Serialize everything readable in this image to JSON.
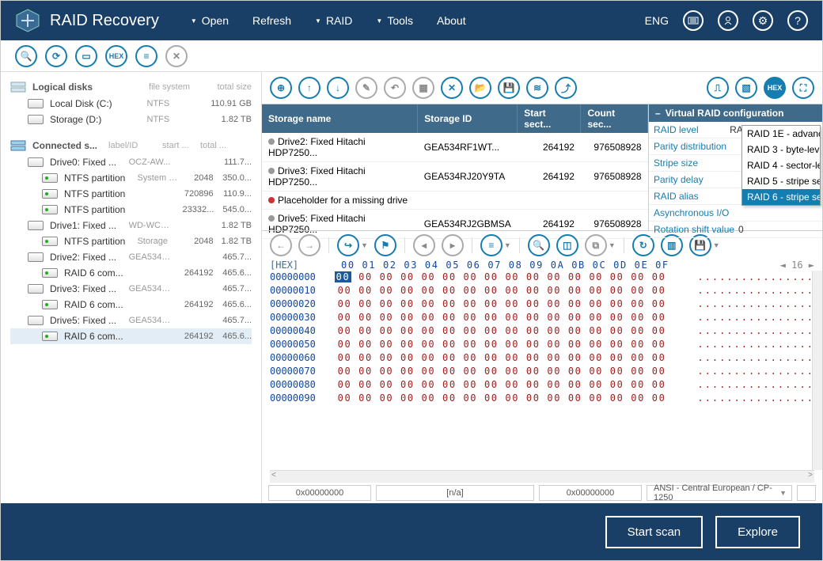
{
  "title": "RAID Recovery",
  "menu": {
    "open": "Open",
    "refresh": "Refresh",
    "raid": "RAID",
    "tools": "Tools",
    "about": "About"
  },
  "lang": "ENG",
  "sidebar": {
    "logical": {
      "title": "Logical disks",
      "col_fs": "file system",
      "col_size": "total size",
      "items": [
        {
          "name": "Local Disk (C:)",
          "fs": "NTFS",
          "size": "110.91 GB"
        },
        {
          "name": "Storage (D:)",
          "fs": "NTFS",
          "size": "1.82 TB"
        }
      ]
    },
    "connected": {
      "title": "Connected s...",
      "col_label": "label/ID",
      "col_start": "start ...",
      "col_total": "total ...",
      "drives": [
        {
          "name": "Drive0: Fixed ...",
          "label": "OCZ-AW...",
          "start": "",
          "total": "111.7...",
          "parts": [
            {
              "name": "NTFS partition",
              "label": "System R...",
              "start": "2048",
              "total": "350.0..."
            },
            {
              "name": "NTFS partition",
              "label": "",
              "start": "720896",
              "total": "110.9..."
            },
            {
              "name": "NTFS partition",
              "label": "",
              "start": "23332...",
              "total": "545.0..."
            }
          ]
        },
        {
          "name": "Drive1: Fixed ...",
          "label": "WD-WCC...",
          "start": "",
          "total": "1.82 TB",
          "parts": [
            {
              "name": "NTFS partition",
              "label": "Storage",
              "start": "2048",
              "total": "1.82 TB"
            }
          ]
        },
        {
          "name": "Drive2: Fixed ...",
          "label": "GEA534R...",
          "start": "",
          "total": "465.7...",
          "parts": [
            {
              "name": "RAID 6 com...",
              "label": "",
              "start": "264192",
              "total": "465.6..."
            }
          ]
        },
        {
          "name": "Drive3: Fixed ...",
          "label": "GEA534R...",
          "start": "",
          "total": "465.7...",
          "parts": [
            {
              "name": "RAID 6 com...",
              "label": "",
              "start": "264192",
              "total": "465.6..."
            }
          ]
        },
        {
          "name": "Drive5: Fixed ...",
          "label": "GEA534R...",
          "start": "",
          "total": "465.7...",
          "parts": [
            {
              "name": "RAID 6 com...",
              "label": "",
              "start": "264192",
              "total": "465.6...",
              "selected": true
            }
          ]
        }
      ]
    }
  },
  "storage": {
    "headers": {
      "name": "Storage name",
      "id": "Storage ID",
      "start": "Start sect...",
      "count": "Count sec..."
    },
    "rows": [
      {
        "name": "Drive2: Fixed Hitachi HDP7250...",
        "id": "GEA534RF1WT...",
        "start": "264192",
        "count": "976508928",
        "dot": "gray"
      },
      {
        "name": "Drive3: Fixed Hitachi HDP7250...",
        "id": "GEA534RJ20Y9TA",
        "start": "264192",
        "count": "976508928",
        "dot": "gray"
      },
      {
        "name": "Placeholder for a missing drive",
        "id": "",
        "start": "",
        "count": "",
        "dot": "red"
      },
      {
        "name": "Drive5: Fixed Hitachi HDP7250...",
        "id": "GEA534RJ2GBMSA",
        "start": "264192",
        "count": "976508928",
        "dot": "gray"
      }
    ]
  },
  "config": {
    "title": "Virtual RAID configuration",
    "rows": {
      "raid_level": "RAID level",
      "raid_level_v": "RAID 5 - stripe se",
      "parity": "Parity distribution",
      "stripe": "Stripe size",
      "pdelay": "Parity delay",
      "alias": "RAID alias",
      "async": "Asynchronous I/O",
      "rotation": "Rotation shift value",
      "rotation_v": "0"
    },
    "dropdown": [
      "RAID 1E - advanc",
      "RAID 3 - byte-lev",
      "RAID 4 - sector-le",
      "RAID 5 - stripe se",
      "RAID 6 - stripe se"
    ],
    "dropdown_sel": 4
  },
  "hex": {
    "label": "[HEX]",
    "cols": "00 01 02 03 04 05 06 07 08 09 0A 0B 0C 0D 0E 0F",
    "nav": "◄  16  ►",
    "lines": [
      {
        "addr": "00000000",
        "bytes": "00 00 00 00 00 00 00 00 00 00 00 00 00 00 00 00",
        "hl0": true,
        "ascii": "................"
      },
      {
        "addr": "00000010",
        "bytes": "00 00 00 00 00 00 00 00 00 00 00 00 00 00 00 00",
        "ascii": "................"
      },
      {
        "addr": "00000020",
        "bytes": "00 00 00 00 00 00 00 00 00 00 00 00 00 00 00 00",
        "ascii": "................"
      },
      {
        "addr": "00000030",
        "bytes": "00 00 00 00 00 00 00 00 00 00 00 00 00 00 00 00",
        "ascii": "................"
      },
      {
        "addr": "00000040",
        "bytes": "00 00 00 00 00 00 00 00 00 00 00 00 00 00 00 00",
        "ascii": "................"
      },
      {
        "addr": "00000050",
        "bytes": "00 00 00 00 00 00 00 00 00 00 00 00 00 00 00 00",
        "ascii": "................"
      },
      {
        "addr": "00000060",
        "bytes": "00 00 00 00 00 00 00 00 00 00 00 00 00 00 00 00",
        "ascii": "................"
      },
      {
        "addr": "00000070",
        "bytes": "00 00 00 00 00 00 00 00 00 00 00 00 00 00 00 00",
        "ascii": "................"
      },
      {
        "addr": "00000080",
        "bytes": "00 00 00 00 00 00 00 00 00 00 00 00 00 00 00 00",
        "ascii": "................"
      },
      {
        "addr": "00000090",
        "bytes": "00 00 00 00 00 00 00 00 00 00 00 00 00 00 00 00",
        "ascii": "................"
      }
    ]
  },
  "status": {
    "a": "0x00000000",
    "b": "[n/a]",
    "c": "0x00000000",
    "enc": "ANSI - Central European / CP-1250"
  },
  "footer": {
    "scan": "Start scan",
    "explore": "Explore"
  }
}
